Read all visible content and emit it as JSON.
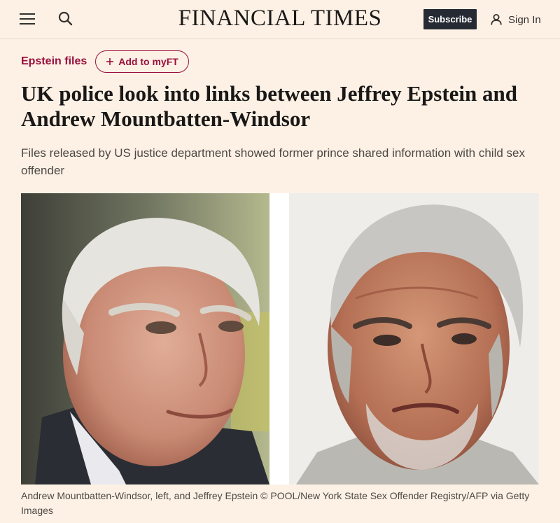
{
  "header": {
    "masthead": "FINANCIAL TIMES",
    "subscribe_label": "Subscribe",
    "signin_label": "Sign In",
    "menu_icon": "hamburger-menu-icon",
    "search_icon": "search-icon",
    "user_icon": "user-icon"
  },
  "article": {
    "topic": "Epstein files",
    "myft_label": "Add to myFT",
    "myft_icon": "plus-icon",
    "headline": "UK police look into links between Jeffrey Epstein and Andrew Mountbatten-Windsor",
    "standfirst": "Files released by US justice department showed former prince shared information with child sex offender",
    "caption": "Andrew Mountbatten-Windsor, left, and Jeffrey Epstein © POOL/New York State Sex Offender Registry/AFP via Getty Images"
  },
  "colors": {
    "background": "#fdf1e5",
    "topic_accent": "#990f3d",
    "subscribe_bg": "#262a33",
    "text": "#33302e"
  }
}
